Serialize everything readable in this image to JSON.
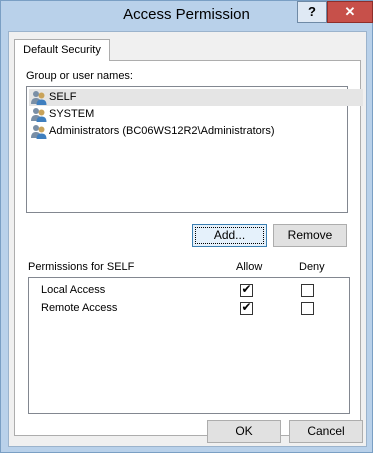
{
  "window": {
    "title": "Access Permission",
    "help_label": "?",
    "close_label": "✕"
  },
  "tabs": [
    {
      "label": "Default Security"
    }
  ],
  "groups": {
    "label": "Group or user names:",
    "items": [
      {
        "name": "SELF",
        "selected": true
      },
      {
        "name": "SYSTEM",
        "selected": false
      },
      {
        "name": "Administrators (BC06WS12R2\\Administrators)",
        "selected": false
      }
    ]
  },
  "buttons": {
    "add": "Add...",
    "remove": "Remove",
    "ok": "OK",
    "cancel": "Cancel"
  },
  "permissions": {
    "label": "Permissions for SELF",
    "allow_header": "Allow",
    "deny_header": "Deny",
    "rows": [
      {
        "name": "Local Access",
        "allow": true,
        "deny": false
      },
      {
        "name": "Remote Access",
        "allow": true,
        "deny": false
      }
    ]
  },
  "icons": {
    "user": "user-group-icon",
    "check": "checkmark-icon"
  }
}
